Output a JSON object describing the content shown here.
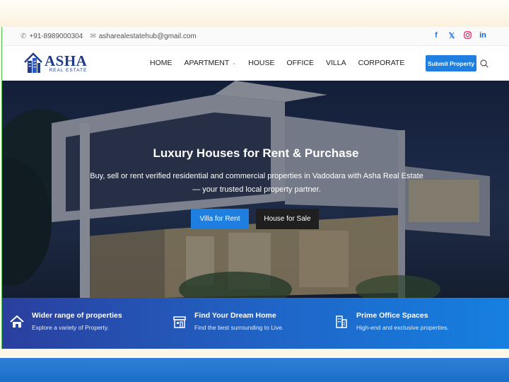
{
  "topbar": {
    "phone": "+91-8989000304",
    "email": "asharealestatehub@gmail.com",
    "social": [
      "facebook-icon",
      "x-icon",
      "instagram-icon",
      "linkedin-icon"
    ]
  },
  "brand": {
    "name": "ASHA",
    "tagline": "REAL ESTATE"
  },
  "nav": {
    "items": [
      "HOME",
      "APARTMENT",
      "HOUSE",
      "OFFICE",
      "VILLA",
      "CORPORATE"
    ],
    "submit_label": "Submit Property"
  },
  "hero": {
    "title": "Luxury Houses for Rent & Purchase",
    "subtitle": "Buy, sell or rent verified residential and commercial properties in Vadodara with Asha Real Estate — your trusted local property partner.",
    "primary_button": "Villa for Rent",
    "secondary_button": "House for Sale"
  },
  "features": [
    {
      "title": "Wider range of properties",
      "desc": "Explore a variety of Property.",
      "icon": "home-icon"
    },
    {
      "title": "Find Your Dream Home",
      "desc": "Find the best surrounding to Live.",
      "icon": "store-icon"
    },
    {
      "title": "Prime Office Spaces",
      "desc": "High-end and exclusive properties.",
      "icon": "building-icon"
    }
  ],
  "colors": {
    "accent": "#1e7fe0",
    "brand": "#1f3b8a",
    "dark_button": "#1f1f1f"
  }
}
